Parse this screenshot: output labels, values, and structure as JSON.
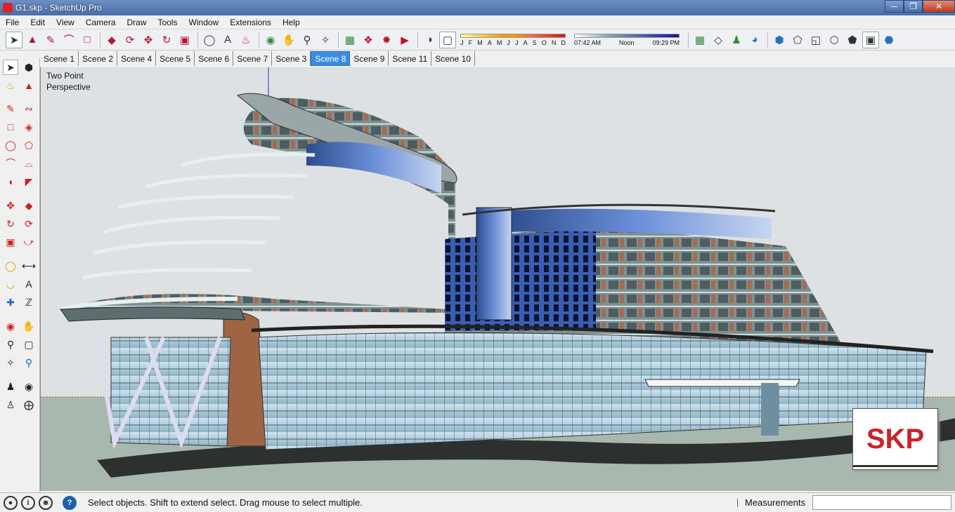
{
  "window": {
    "title": "G1.skp - SketchUp Pro"
  },
  "menus": [
    "File",
    "Edit",
    "View",
    "Camera",
    "Draw",
    "Tools",
    "Window",
    "Extensions",
    "Help"
  ],
  "shadow": {
    "months": [
      "J",
      "F",
      "M",
      "A",
      "M",
      "J",
      "J",
      "A",
      "S",
      "O",
      "N",
      "D"
    ],
    "sunrise": "07:42 AM",
    "noon": "Noon",
    "sunset": "09:29 PM"
  },
  "scenes": {
    "tabs": [
      "Scene 1",
      "Scene 2",
      "Scene 4",
      "Scene 5",
      "Scene 6",
      "Scene 7",
      "Scene 3",
      "Scene 8",
      "Scene 9",
      "Scene 11",
      "Scene 10"
    ],
    "active": "Scene 8"
  },
  "viewport": {
    "camera_label_1": "Two Point",
    "camera_label_2": "Perspective",
    "badge": "SKP"
  },
  "status": {
    "message": "Select objects. Shift to extend select. Drag mouse to select multiple.",
    "measurements_label": "Measurements",
    "measurements_value": ""
  },
  "colors": {
    "active_tab": "#3a8de0",
    "badge_text": "#c8242a",
    "title_bar": "#4a6fa8"
  }
}
